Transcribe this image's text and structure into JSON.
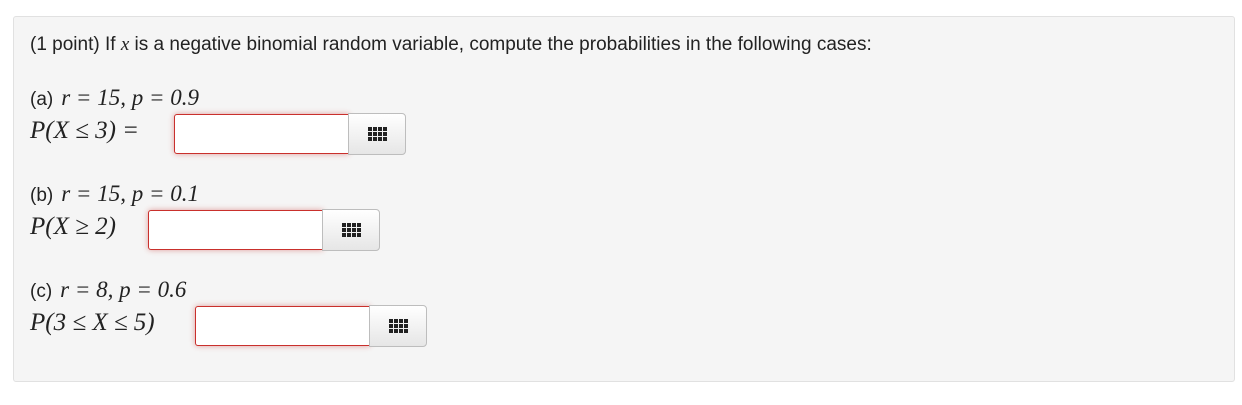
{
  "problem": {
    "points_label": "(1 point)",
    "intro_before": "If",
    "variable": "x",
    "intro_after": "is a negative binomial random variable, compute the probabilities in the following cases:"
  },
  "parts": [
    {
      "label": "(a)",
      "params": "r = 15, p = 0.9",
      "expression": "P(X ≤ 3) =",
      "answer_value": "",
      "palette_icon": "grid-icon"
    },
    {
      "label": "(b)",
      "params": "r = 15, p = 0.1",
      "expression": "P(X ≥ 2)",
      "answer_value": "",
      "palette_icon": "grid-icon"
    },
    {
      "label": "(c)",
      "params": "r = 8, p = 0.6",
      "expression": "P(3 ≤ X ≤ 5)",
      "answer_value": "",
      "palette_icon": "grid-icon"
    }
  ],
  "colors": {
    "panel_background": "#f5f5f5",
    "invalid_border": "#c9302c"
  }
}
